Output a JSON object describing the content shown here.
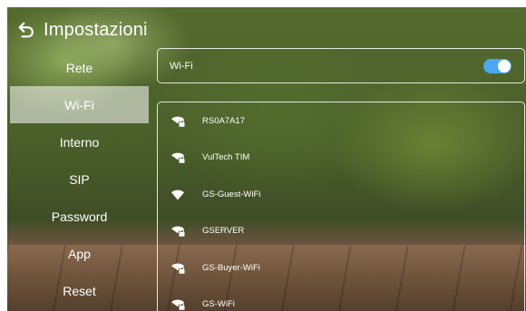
{
  "header": {
    "back_icon": "back-arrow-icon",
    "title": "Impostazioni"
  },
  "menu": {
    "items": [
      {
        "label": "Rete",
        "selected": false
      },
      {
        "label": "Wi-Fi",
        "selected": true
      },
      {
        "label": "Interno",
        "selected": false
      },
      {
        "label": "SIP",
        "selected": false
      },
      {
        "label": "Password",
        "selected": false
      },
      {
        "label": "App",
        "selected": false
      },
      {
        "label": "Reset",
        "selected": false
      }
    ]
  },
  "wifi": {
    "label": "Wi-Fi",
    "enabled": true,
    "toggle_color": "#4aa8ee"
  },
  "networks": [
    {
      "ssid": "RS0A7A17",
      "icon": "wifi-locked-icon",
      "secured": true
    },
    {
      "ssid": "VulTech TIM",
      "icon": "wifi-locked-icon",
      "secured": true
    },
    {
      "ssid": "GS-Guest-WiFi",
      "icon": "wifi-icon",
      "secured": false
    },
    {
      "ssid": "GSERVER",
      "icon": "wifi-locked-icon",
      "secured": true
    },
    {
      "ssid": "GS-Buyer-WiFi",
      "icon": "wifi-locked-icon",
      "secured": true
    },
    {
      "ssid": "GS-WiFi",
      "icon": "wifi-locked-icon",
      "secured": true
    }
  ]
}
